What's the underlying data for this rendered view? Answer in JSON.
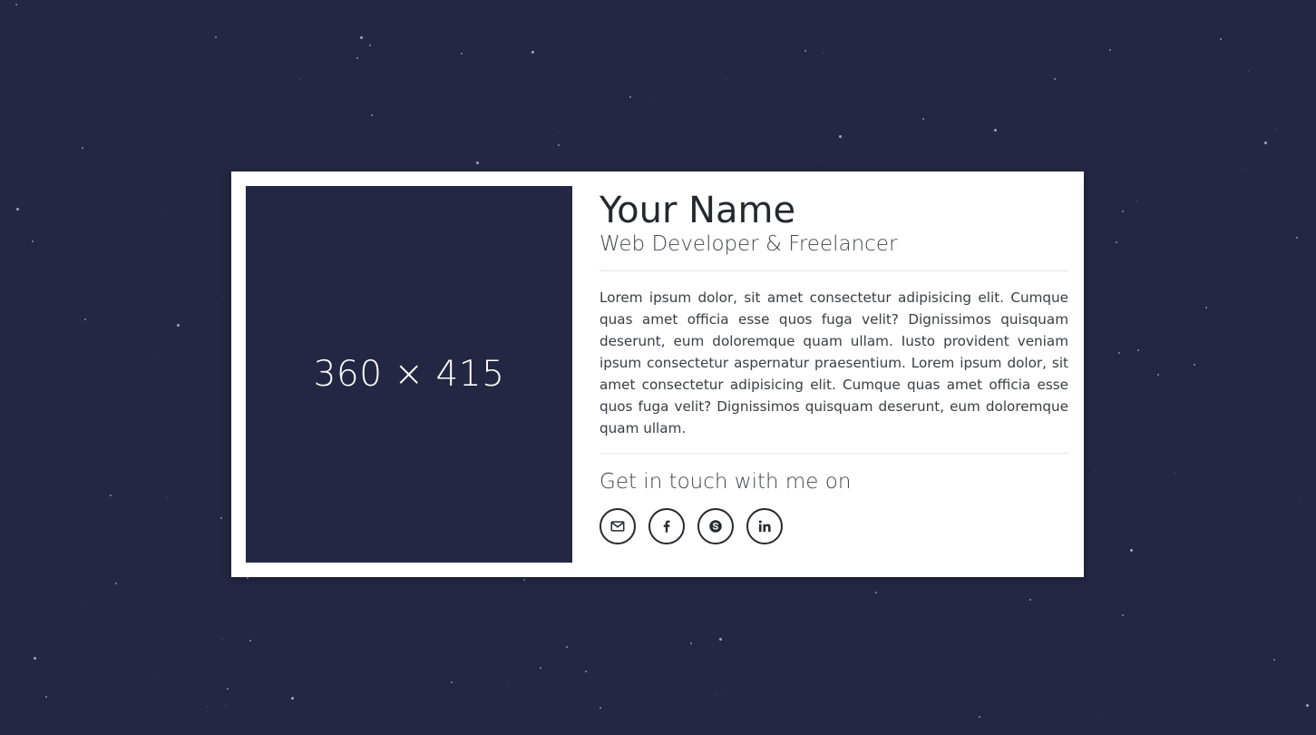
{
  "profile": {
    "name": "Your Name",
    "title": "Web Developer & Freelancer",
    "photo_placeholder": "360 × 415",
    "bio": "Lorem ipsum dolor, sit amet consectetur adipisicing elit. Cumque quas amet officia esse quos fuga velit? Dignissimos quisquam deserunt, eum doloremque quam ullam. Iusto provident veniam ipsum consectetur aspernatur praesentium. Lorem ipsum dolor, sit amet consectetur adipisicing elit. Cumque quas amet officia esse quos fuga velit? Dignissimos quisquam deserunt, eum doloremque quam ullam."
  },
  "contact": {
    "heading": "Get in touch with me on",
    "links": [
      {
        "icon": "email-icon"
      },
      {
        "icon": "facebook-icon"
      },
      {
        "icon": "skype-icon"
      },
      {
        "icon": "linkedin-icon"
      }
    ]
  },
  "colors": {
    "background": "#232743",
    "card": "#ffffff",
    "text": "#26282f",
    "star": "#b7bbd1"
  }
}
